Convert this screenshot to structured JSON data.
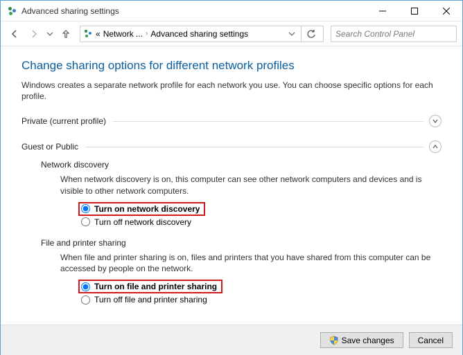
{
  "window": {
    "title": "Advanced sharing settings"
  },
  "toolbar": {
    "breadcrumb": {
      "part1": "Network ...",
      "part2": "Advanced sharing settings"
    },
    "search_placeholder": "Search Control Panel"
  },
  "content": {
    "heading": "Change sharing options for different network profiles",
    "intro": "Windows creates a separate network profile for each network you use. You can choose specific options for each profile.",
    "private_title": "Private (current profile)",
    "guest_title": "Guest or Public",
    "net_disc": {
      "title": "Network discovery",
      "desc": "When network discovery is on, this computer can see other network computers and devices and is visible to other network computers.",
      "on": "Turn on network discovery",
      "off": "Turn off network discovery"
    },
    "fp_share": {
      "title": "File and printer sharing",
      "desc": "When file and printer sharing is on, files and printers that you have shared from this computer can be accessed by people on the network.",
      "on": "Turn on file and printer sharing",
      "off": "Turn off file and printer sharing"
    }
  },
  "footer": {
    "save": "Save changes",
    "cancel": "Cancel"
  }
}
